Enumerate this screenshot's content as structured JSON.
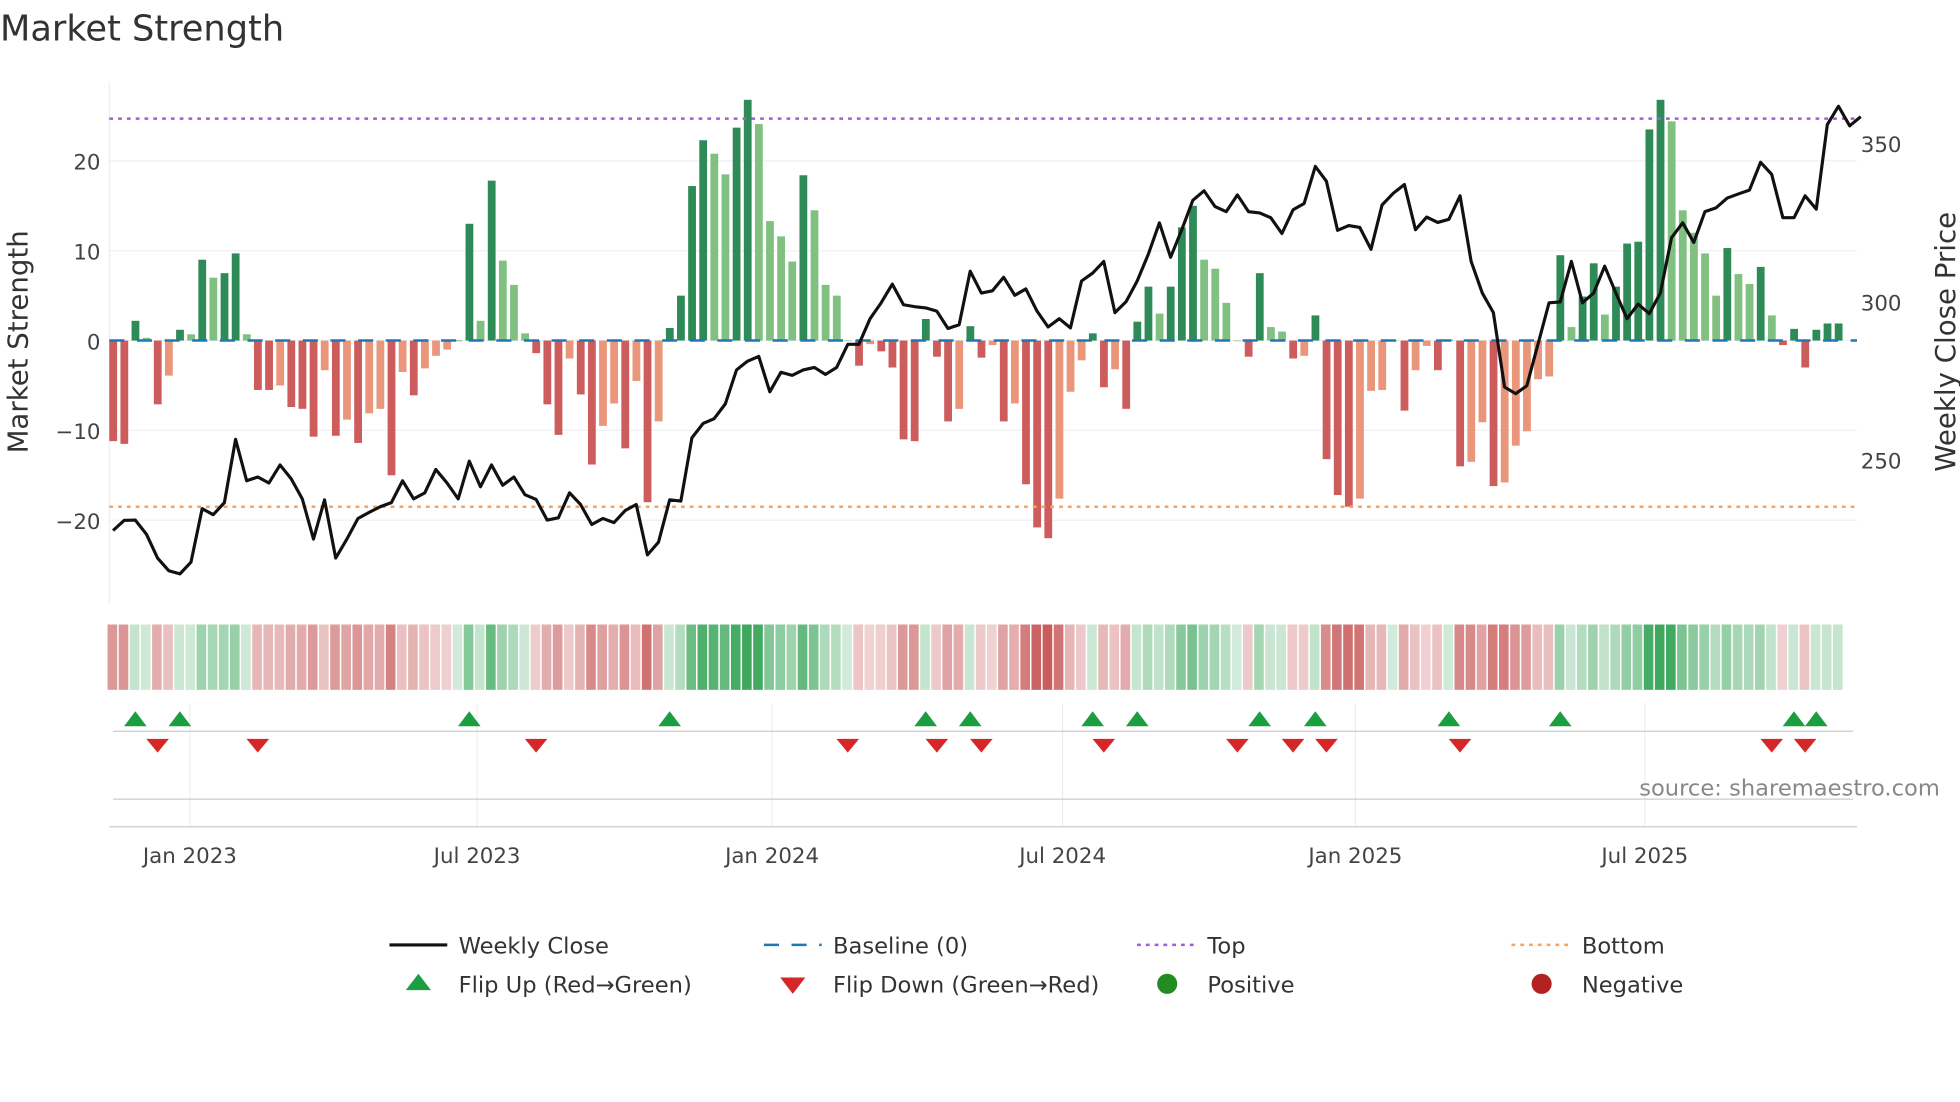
{
  "chart_data": {
    "type": "bar",
    "title": "Market Strength",
    "ylabel": "Market Strength",
    "y2label": "Weekly Close Price",
    "ylim": [
      -29,
      29
    ],
    "y2lim": [
      207,
      373
    ],
    "yticks": [
      -20,
      -10,
      0,
      10,
      20
    ],
    "y2ticks": [
      250,
      300,
      350
    ],
    "xticks": [
      {
        "label": "Jan 2023",
        "week": 6.9
      },
      {
        "label": "Jul 2023",
        "week": 32.7
      },
      {
        "label": "Jan 2024",
        "week": 59.2
      },
      {
        "label": "Jul 2024",
        "week": 85.3
      },
      {
        "label": "Jan 2025",
        "week": 111.6
      },
      {
        "label": "Jul 2025",
        "week": 137.6
      }
    ],
    "top_level": 24.7,
    "bottom_level": -18.5,
    "strength": [
      -11.2,
      -11.5,
      2.2,
      0.3,
      -7.1,
      -3.9,
      1.2,
      0.7,
      9,
      7,
      7.5,
      9.7,
      0.7,
      -5.5,
      -5.5,
      -5,
      -7.4,
      -7.6,
      -10.7,
      -3.3,
      -10.6,
      -8.8,
      -11.4,
      -8.1,
      -7.6,
      -15,
      -3.5,
      -6.1,
      -3.1,
      -1.7,
      -1,
      0,
      13,
      2.2,
      17.8,
      8.9,
      6.2,
      0.8,
      -1.4,
      -7.1,
      -10.5,
      -2,
      -6,
      -13.8,
      -9.5,
      -7,
      -12,
      -4.5,
      -18,
      -9,
      1.4,
      5,
      17.2,
      22.3,
      20.8,
      18.5,
      23.7,
      26.8,
      24.1,
      13.3,
      11.6,
      8.8,
      18.4,
      14.5,
      6.2,
      5,
      0,
      -2.8,
      -0.4,
      -1.2,
      -3,
      -11,
      -11.2,
      2.4,
      -1.8,
      -9,
      -7.6,
      1.6,
      -1.9,
      -0.5,
      -9,
      -7,
      -16,
      -20.8,
      -22,
      -17.6,
      -5.7,
      -2.2,
      0.8,
      -5.2,
      -3.2,
      -7.6,
      2.1,
      6,
      3,
      6,
      12.6,
      15,
      9,
      8,
      4.2,
      0,
      -1.8,
      7.5,
      1.5,
      1,
      -2,
      -1.7,
      2.8,
      -13.2,
      -17.2,
      -18.5,
      -17.6,
      -5.6,
      -5.5,
      0,
      -7.8,
      -3.3,
      -0.6,
      -3.3,
      0.1,
      -14,
      -13.5,
      -9.1,
      -16.2,
      -15.8,
      -11.7,
      -10.1,
      -4.3,
      -4,
      9.5,
      1.5,
      4.9,
      8.6,
      2.9,
      6,
      10.8,
      11,
      23.5,
      26.8,
      24.4,
      14.5,
      12,
      9.7,
      5,
      10.3,
      7.4,
      6.3,
      8.2,
      2.8,
      -0.5,
      1.3,
      -3,
      1.2,
      1.9,
      1.9
    ],
    "weekly_close": [
      227.7,
      230.9,
      231,
      226.5,
      219,
      215,
      214,
      217.7,
      234.6,
      232.7,
      236.5,
      256.5,
      243.4,
      244.6,
      242.7,
      248.4,
      244,
      237.7,
      225,
      237.4,
      219,
      225,
      231.5,
      233.4,
      235.2,
      236.5,
      243.4,
      237.7,
      239.6,
      247,
      242.7,
      237.7,
      249.6,
      241.5,
      248.4,
      242,
      244.6,
      239,
      237.5,
      231,
      231.7,
      239.6,
      235.9,
      229.6,
      231.5,
      230.2,
      234,
      235.9,
      220,
      224,
      237.4,
      237,
      257,
      261.5,
      263,
      267.7,
      278.4,
      281.2,
      282.7,
      271.5,
      277.7,
      276.7,
      278.4,
      279.2,
      277,
      279.2,
      286.5,
      286.5,
      294.6,
      299.6,
      305.5,
      299,
      298.4,
      298,
      297,
      291.5,
      292.7,
      309.6,
      302.7,
      303.4,
      307.7,
      302,
      304,
      297,
      292,
      294.6,
      291.7,
      306.5,
      309,
      312.7,
      296.5,
      300,
      306.5,
      315,
      324.9,
      314,
      322.7,
      332,
      335,
      330,
      328.4,
      333.7,
      328.4,
      328,
      326.5,
      321.5,
      329,
      331,
      342.7,
      338,
      322.5,
      324,
      323.4,
      316.5,
      330.5,
      334.2,
      337,
      322.7,
      326.7,
      325,
      326,
      333.4,
      312.7,
      302.7,
      296.5,
      273,
      270.9,
      273.4,
      286.5,
      299.6,
      299.9,
      312.7,
      299.6,
      302.7,
      311.2,
      302.7,
      294.6,
      299.2,
      296.2,
      302.7,
      320.2,
      324.9,
      318.7,
      328.4,
      329.6,
      332.7,
      334,
      335.2,
      344,
      340.2,
      326.5,
      326.5,
      333.4,
      329.2,
      355.9,
      361.7,
      355.5,
      358.4
    ],
    "flip_up_weeks": [
      2,
      6,
      32,
      50,
      73,
      77,
      88,
      92,
      103,
      108,
      120,
      130,
      151,
      153
    ],
    "flip_down_weeks": [
      4,
      13,
      38,
      66,
      74,
      78,
      89,
      101,
      106,
      109,
      121,
      149,
      152
    ],
    "legend": {
      "position": "bottom",
      "items": [
        {
          "key": "close",
          "label": "Weekly Close"
        },
        {
          "key": "baseline",
          "label": "Baseline (0)"
        },
        {
          "key": "top",
          "label": "Top"
        },
        {
          "key": "bottom",
          "label": "Bottom"
        },
        {
          "key": "flip_up",
          "label": "Flip Up (Red→Green)"
        },
        {
          "key": "flip_down",
          "label": "Flip Down (Green→Red)"
        },
        {
          "key": "positive",
          "label": "Positive"
        },
        {
          "key": "negative",
          "label": "Negative"
        }
      ]
    },
    "source": "source: sharemaestro.com"
  },
  "colors": {
    "green_dark": "#2e8b57",
    "green_light": "#80c080",
    "red_dark": "#cd5c5c",
    "red_light": "#e9967a",
    "top": "#9b5fd6",
    "bottom": "#f4a460",
    "baseline": "#1f77b4",
    "close": "#111111",
    "flip_up": "#1a9e3f",
    "flip_down": "#d62728",
    "positive": "#228b22",
    "negative": "#b22222"
  }
}
